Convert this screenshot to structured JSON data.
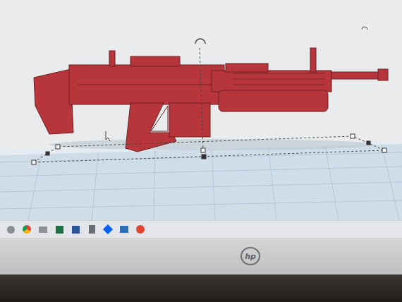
{
  "monitor": {
    "brand": "hp"
  },
  "model": {
    "selected": true
  }
}
